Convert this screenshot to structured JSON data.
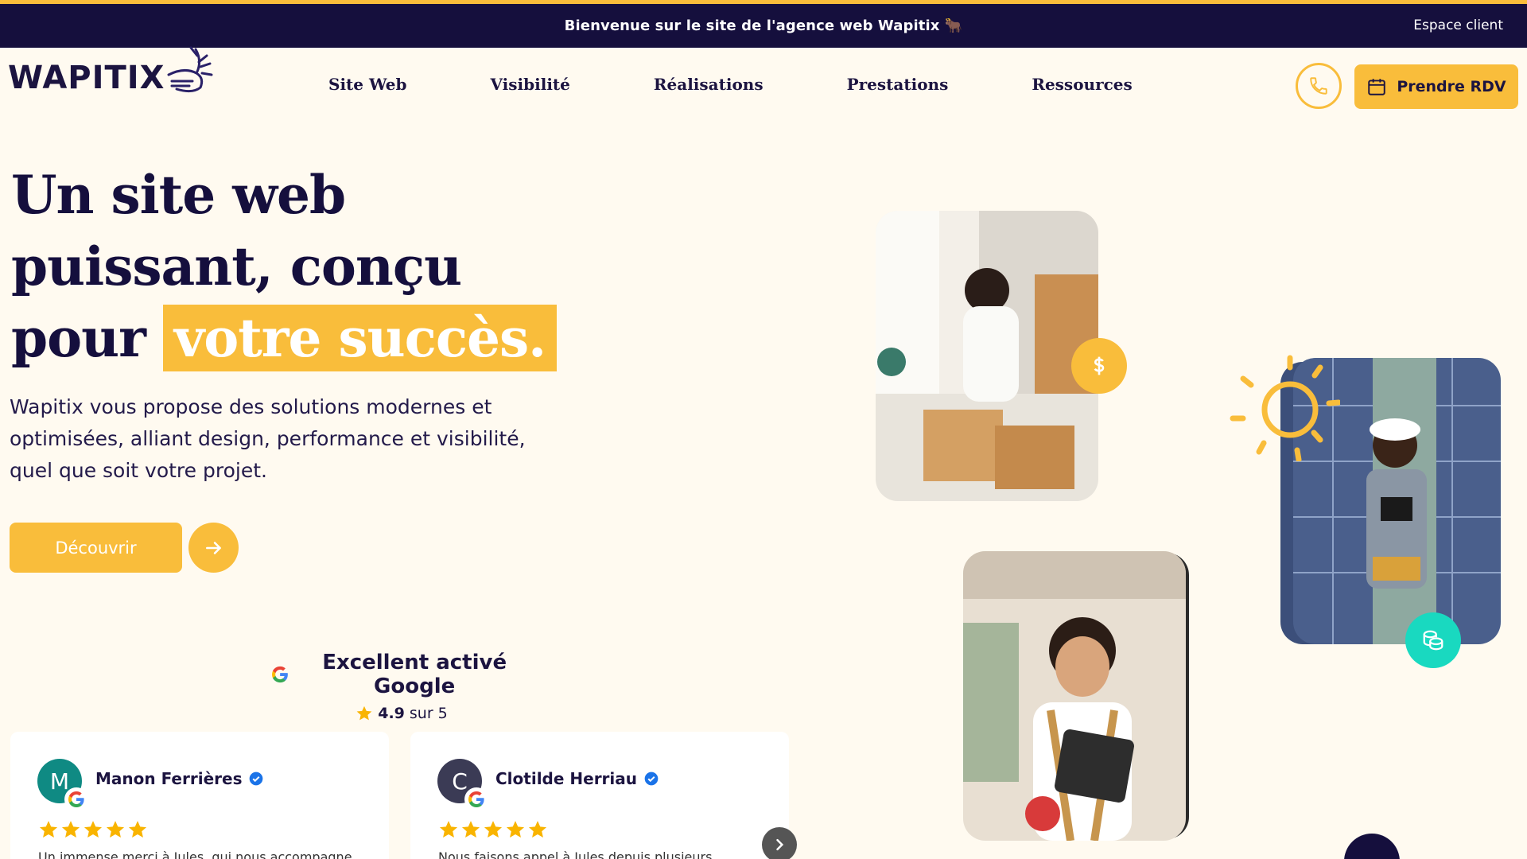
{
  "topbar": {
    "message": "Bienvenue sur le site de l'agence web Wapitix 🐂",
    "client_link": "Espace client"
  },
  "logo": {
    "text": "WAPITIX"
  },
  "nav": {
    "items": [
      {
        "label": "Site Web"
      },
      {
        "label": "Visibilité"
      },
      {
        "label": "Réalisations"
      },
      {
        "label": "Prestations"
      },
      {
        "label": "Ressources"
      }
    ],
    "rdv_label": "Prendre RDV"
  },
  "hero": {
    "title_line1": "Un site web",
    "title_line2": "puissant, conçu",
    "title_line3_start": "pour",
    "title_highlight": "votre succès.",
    "description": "Wapitix vous propose des solutions modernes et optimisées, alliant design, performance et visibilité, quel que soit votre projet.",
    "cta_label": "Découvrir"
  },
  "rating": {
    "headline": "Excellent activé Google",
    "score": "4.9",
    "scale": "sur 5"
  },
  "reviews": [
    {
      "name": "Manon Ferrières",
      "initial": "M",
      "stars": 5,
      "excerpt": "Un immense merci à Jules, qui nous accompagne"
    },
    {
      "name": "Clotilde Herriau",
      "initial": "C",
      "stars": 5,
      "excerpt": "Nous faisons appel à Jules depuis plusieurs"
    }
  ],
  "colors": {
    "brand_dark": "#150f3d",
    "accent": "#f9bd3b",
    "background": "#fffaf0",
    "teal_badge": "#19d9c0"
  },
  "icons": {
    "phone": "phone-icon",
    "calendar": "calendar-icon",
    "arrow": "arrow-right-icon",
    "dollar": "dollar-icon",
    "coins": "coins-icon",
    "sun": "sun-icon",
    "google": "google-icon",
    "verified": "verified-icon",
    "chevron": "chevron-right-icon"
  }
}
